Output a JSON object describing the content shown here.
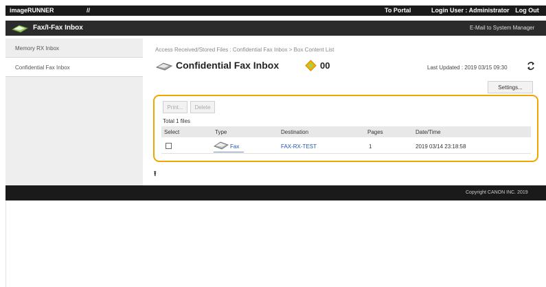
{
  "topbar": {
    "brand": "imageRUNNER",
    "separator": "//",
    "portal_link": "To Portal",
    "login_label": "Login User : Administrator",
    "logout": "Log Out"
  },
  "titlebar": {
    "title": "Fax/I-Fax Inbox",
    "mail_link": "E-Mail to System Manager"
  },
  "sidebar": {
    "items": [
      {
        "label": "Memory RX Inbox"
      },
      {
        "label": "Confidential Fax Inbox"
      }
    ]
  },
  "main": {
    "breadcrumb": "Access Received/Stored Files : Confidential Fax Inbox > Box Content List",
    "title": "Confidential Fax Inbox",
    "box_number": "00",
    "last_updated": "Last Updated : 2019 03/15 09:30",
    "settings_button": "Settings...",
    "print_button": "Print...",
    "delete_button": "Delete",
    "total_files": "Total 1 files",
    "table": {
      "columns": [
        "Select",
        "Type",
        "Destination",
        "Pages",
        "Date/Time"
      ],
      "rows": [
        {
          "type": "Fax",
          "destination": "FAX-RX-TEST",
          "pages": "1",
          "datetime": "2019 03/14 23:18:58"
        }
      ]
    }
  },
  "footer": {
    "copyright": "Copyright CANON INC. 2019"
  },
  "colors": {
    "accent": "#f0a500",
    "header_bg": "#1a1a1a",
    "link": "#2255aa"
  },
  "icons": [
    "fax-inbox-icon",
    "box-number-icon",
    "refresh-icon",
    "fax-type-icon",
    "scroll-top-icon"
  ]
}
